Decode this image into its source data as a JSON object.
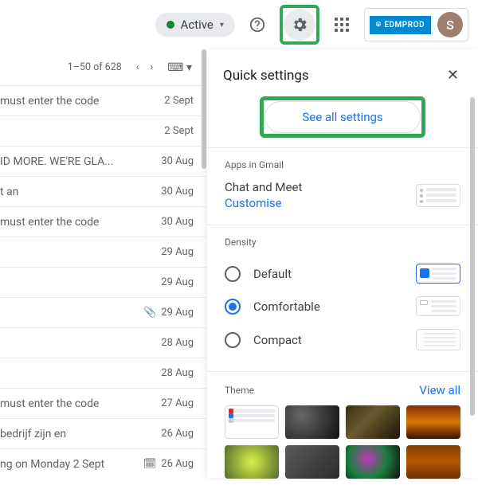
{
  "topbar": {
    "active_label": "Active",
    "brand": "EDMPROD",
    "avatar_letter": "S"
  },
  "inbox": {
    "range": "1–50 of 628",
    "rows": [
      {
        "subj": "must enter the code",
        "date": "2 Sept"
      },
      {
        "subj": "",
        "date": "2 Sept"
      },
      {
        "subj": "ID MORE. WE'RE GLA...",
        "date": "30 Aug"
      },
      {
        "subj": "t an",
        "date": "30 Aug"
      },
      {
        "subj": "must enter the code",
        "date": "30 Aug"
      },
      {
        "subj": "",
        "date": "29 Aug"
      },
      {
        "subj": "",
        "date": "29 Aug"
      },
      {
        "subj": "",
        "date": "29 Aug",
        "attach": true
      },
      {
        "subj": "",
        "date": "28 Aug"
      },
      {
        "subj": "",
        "date": "28 Aug"
      },
      {
        "subj": "must enter the code",
        "date": "27 Aug"
      },
      {
        "subj": "bedrijf zijn en",
        "date": "26 Aug"
      },
      {
        "subj": "ng on Monday 2 Sept",
        "date": "26 Aug",
        "cal": true
      }
    ]
  },
  "panel": {
    "title": "Quick settings",
    "see_all": "See all settings",
    "apps": {
      "section": "Apps in Gmail",
      "name": "Chat and Meet",
      "customise": "Customise"
    },
    "density": {
      "section": "Density",
      "options": [
        "Default",
        "Comfortable",
        "Compact"
      ],
      "selected": 1
    },
    "theme": {
      "section": "Theme",
      "view_all": "View all"
    }
  }
}
